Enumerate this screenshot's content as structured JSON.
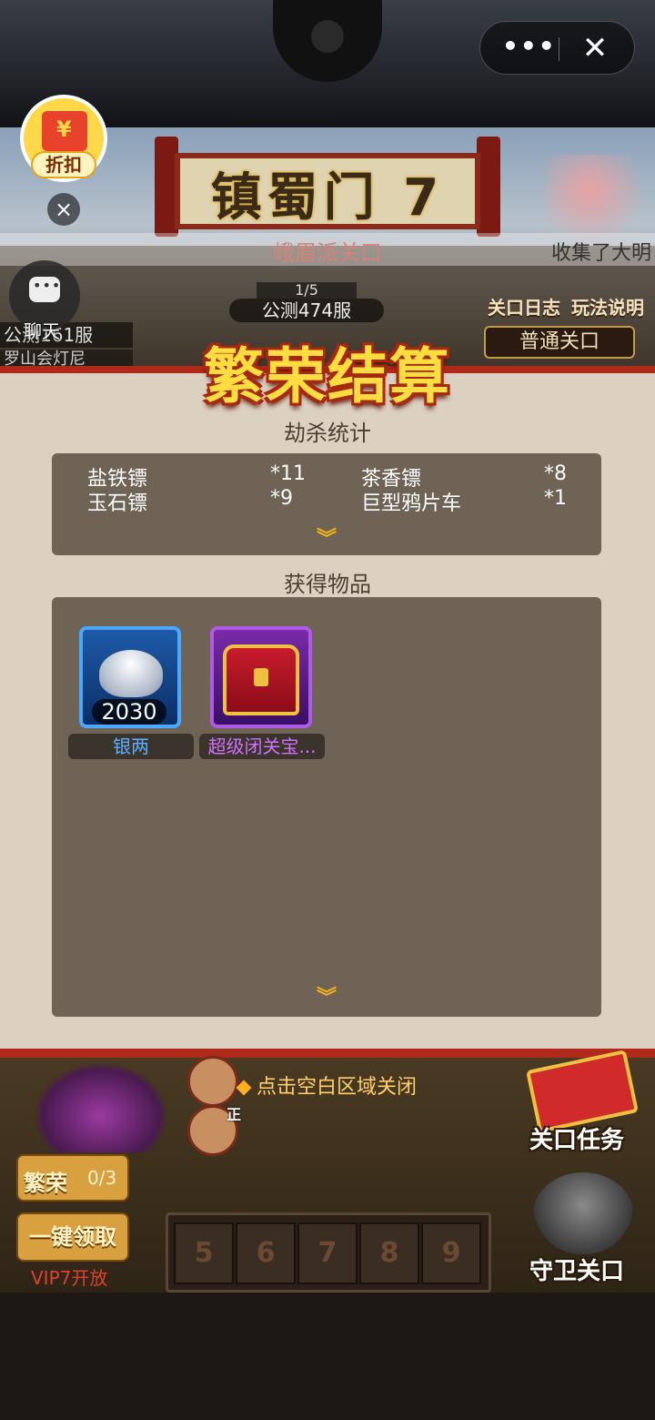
{
  "capsule": {
    "more_icon": "more-dots-icon",
    "close_icon": "close-x-icon",
    "more_symbol": "•••",
    "close_symbol": "✕"
  },
  "discount": {
    "label": "折扣",
    "close_symbol": "×"
  },
  "chat": {
    "label": "聊天"
  },
  "stage": {
    "title": "镇蜀门 7",
    "subtitle": "峨眉派关口",
    "ticker": "收集了大明",
    "page_indicator": "1/5",
    "server": "公测474服",
    "left_server": "公测161服",
    "left_server_2": "罗山会灯尼",
    "log_label": "关口日志",
    "rules_label": "玩法说明",
    "normal_label": "普通关口"
  },
  "result": {
    "title": "繁荣结算",
    "kill_section": "劫杀统计",
    "kills": [
      {
        "name": "盐铁镖",
        "count": "*11"
      },
      {
        "name": "茶香镖",
        "count": "*8"
      },
      {
        "name": "玉石镖",
        "count": "*9"
      },
      {
        "name": "巨型鸦片车",
        "count": "*1"
      }
    ],
    "items_section": "获得物品",
    "items": [
      {
        "name": "银两",
        "count": "2030",
        "name_color": "#5ab0ff"
      },
      {
        "name": "超级闭关宝...",
        "count": "",
        "name_color": "#d070ff"
      }
    ],
    "chevron": "︾"
  },
  "bottom": {
    "close_hint": "点击空白区域关闭",
    "fanrong_label": "繁荣",
    "fanrong_count": "0/3",
    "claim_label": "一键领取",
    "vip_text": "VIP7开放",
    "slots": [
      "5",
      "6",
      "7",
      "8",
      "9"
    ],
    "task_label": "关口任务",
    "guard_label": "守卫关口",
    "face_tag": "正"
  }
}
